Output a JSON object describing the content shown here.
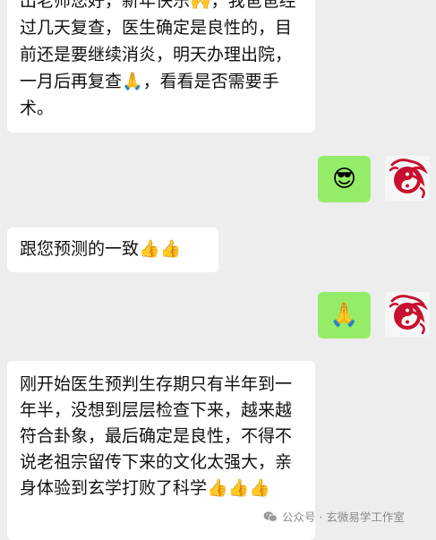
{
  "messages": {
    "m1": {
      "text": "出老师您好，新年快乐🙌，我爸爸经过几天复查，医生确定是良性的，目前还是要继续消炎，明天办理出院，一月后再复查🙏，看看是否需要手术。"
    },
    "m2": {
      "emoji": "😎"
    },
    "m3": {
      "text": "跟您预测的一致👍👍"
    },
    "m4": {
      "emoji": "🙏"
    },
    "m5": {
      "text": "刚开始医生预判生存期只有半年到一年半，没想到层层检查下来，越来越符合卦象，最后确定是良性，不得不说老祖宗留传下来的文化太强大，亲身体验到玄学打败了科学👍👍👍"
    }
  },
  "avatar": {
    "icon": "dragon-yin-yang-icon"
  },
  "watermark": {
    "label": "公众号 · 玄微易学工作室",
    "icon": "wechat-icon"
  },
  "colors": {
    "background": "#ededed",
    "sent_bubble": "#95ec69",
    "received_bubble": "#ffffff",
    "avatar_red": "#c8102e"
  }
}
